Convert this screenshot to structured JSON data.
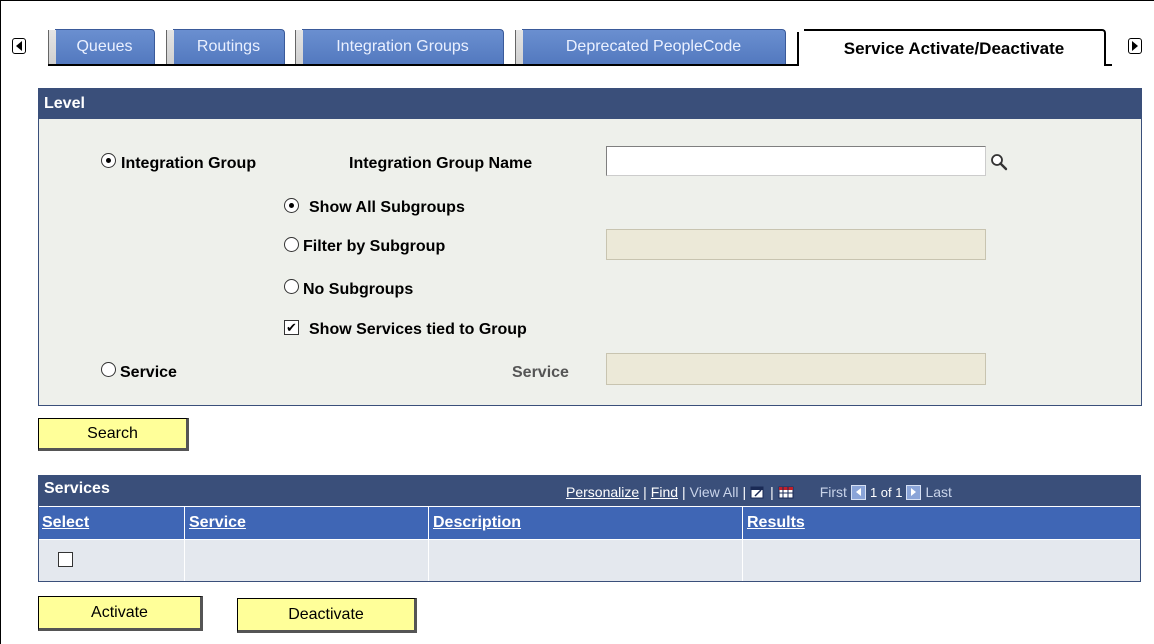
{
  "tabs": {
    "items": [
      {
        "label": "Queues"
      },
      {
        "label": "Routings"
      },
      {
        "label": "Integration Groups"
      },
      {
        "label": "Deprecated PeopleCode"
      },
      {
        "label": "Service Activate/Deactivate"
      }
    ],
    "active_index": 4
  },
  "level": {
    "header": "Level",
    "integration_group_radio": {
      "label": "Integration Group",
      "checked": true
    },
    "integration_group_name_label": "Integration Group Name",
    "integration_group_name_value": "",
    "subgroup_options": [
      {
        "label": "Show All Subgroups",
        "checked": true
      },
      {
        "label": "Filter by Subgroup",
        "checked": false
      },
      {
        "label": "No Subgroups",
        "checked": false
      }
    ],
    "filter_subgroup_value": "",
    "show_services_checkbox": {
      "label": "Show Services tied to Group",
      "checked": true
    },
    "service_radio": {
      "label": "Service",
      "checked": false
    },
    "service_field_label": "Service",
    "service_value": ""
  },
  "buttons": {
    "search": "Search",
    "activate": "Activate",
    "deactivate": "Deactivate"
  },
  "services_grid": {
    "title": "Services",
    "personalize": "Personalize",
    "separator": "|",
    "find": "Find",
    "view_all": "View All",
    "first": "First",
    "page_info": "1 of 1",
    "last": "Last",
    "columns": [
      "Select",
      "Service",
      "Description",
      "Results"
    ],
    "rows": [
      {
        "select": false,
        "service": "",
        "description": "",
        "results": ""
      }
    ]
  },
  "colors": {
    "header_bg": "#3a4f7a",
    "column_header_bg": "#3f66b5",
    "button_bg": "#ffff99",
    "section_bg": "#eef0eb"
  }
}
